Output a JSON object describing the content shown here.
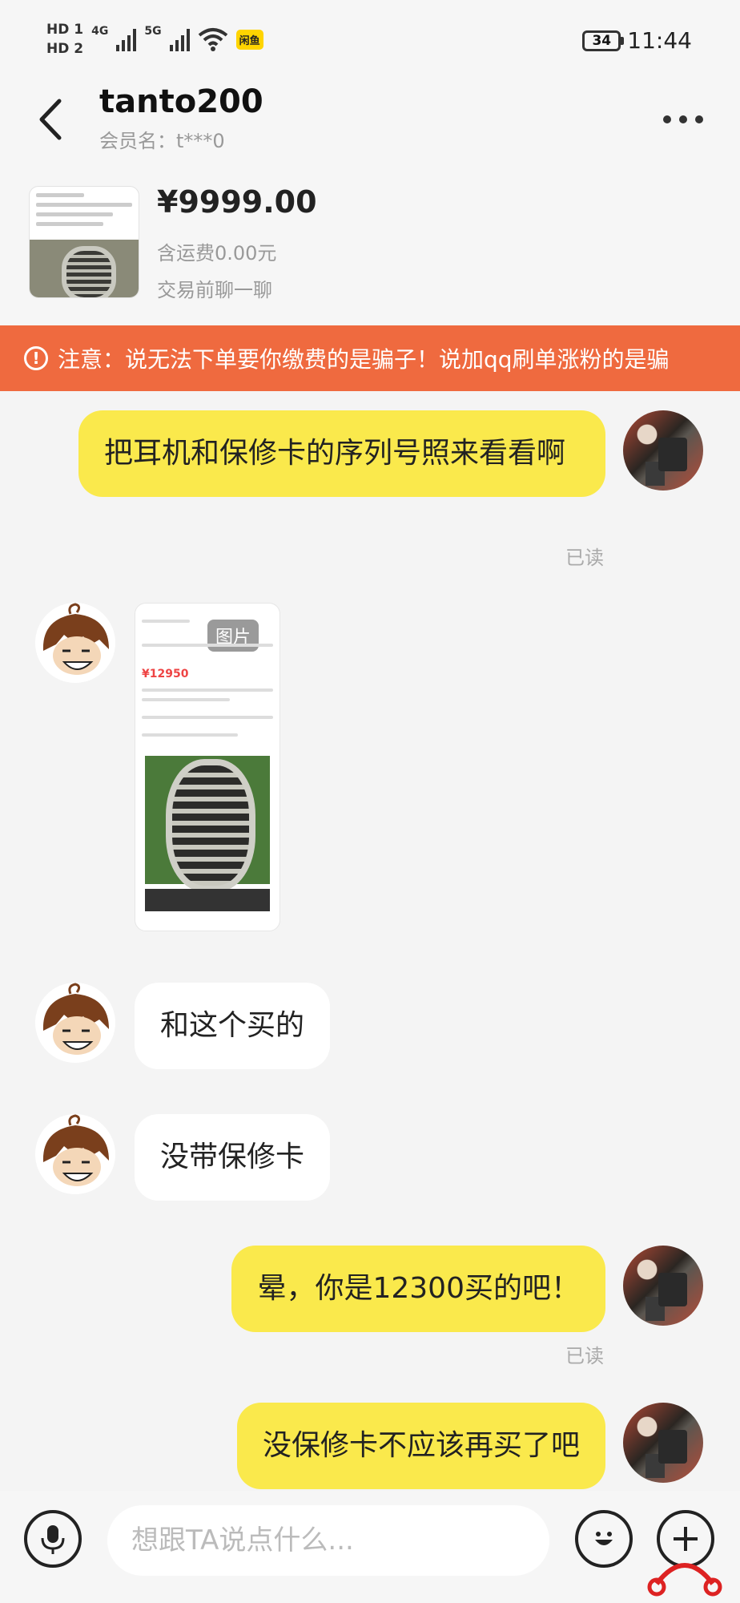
{
  "status_bar": {
    "hd1": "HD 1",
    "hd2": "HD 2",
    "net1": "4G",
    "net2": "5G",
    "app_badge": "闲鱼",
    "battery": "34",
    "time": "11:44"
  },
  "header": {
    "title": "tanto200",
    "subtitle": "会员名：t***0"
  },
  "product": {
    "price": "¥9999.00",
    "shipping": "含运费0.00元",
    "hint": "交易前聊一聊"
  },
  "warning": {
    "text": "注意：说无法下单要你缴费的是骗子！说加qq刷单涨粉的是骗"
  },
  "messages": [
    {
      "sender": "me",
      "text": "把耳机和保修卡的序列号照来看看啊",
      "status": "已读"
    },
    {
      "sender": "them",
      "type": "image",
      "tag": "图片",
      "price_in_image": "¥12950"
    },
    {
      "sender": "them",
      "text": "和这个买的"
    },
    {
      "sender": "them",
      "text": "没带保修卡"
    },
    {
      "sender": "me",
      "text": "晕，你是12300买的吧！",
      "status": "已读"
    },
    {
      "sender": "me",
      "text": "没保修卡不应该再买了吧"
    }
  ],
  "input": {
    "placeholder": "想跟TA说点什么..."
  },
  "colors": {
    "my_bubble": "#fae94c",
    "their_bubble": "#ffffff",
    "warning_bg": "#ef6a3f",
    "background": "#f4f4f4"
  },
  "icons": [
    "back-arrow-icon",
    "more-dots-icon",
    "alert-icon",
    "microphone-icon",
    "emoji-icon",
    "plus-icon",
    "wifi-icon",
    "signal-icon"
  ]
}
